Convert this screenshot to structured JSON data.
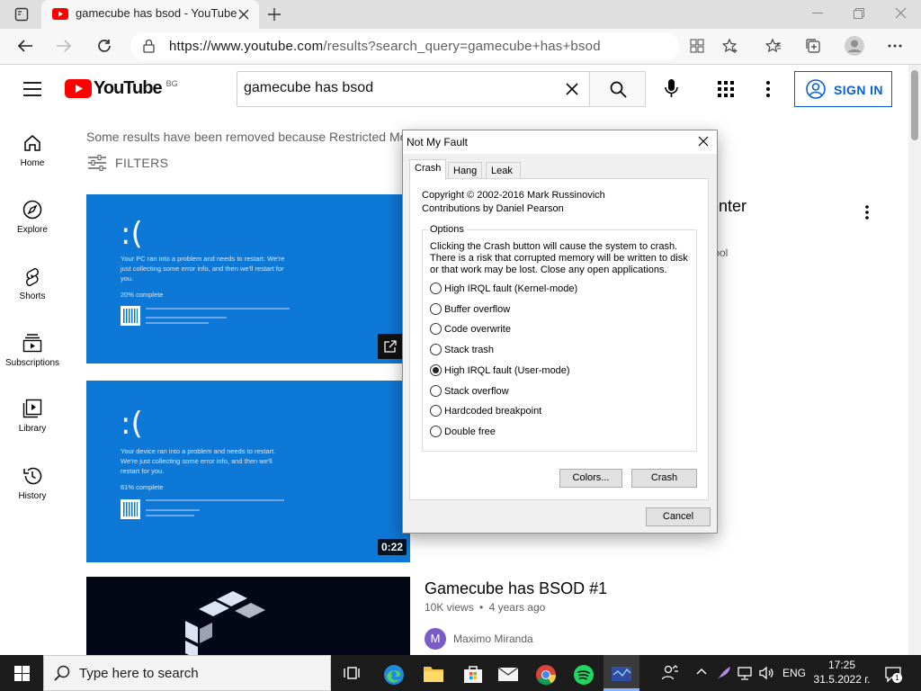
{
  "browser": {
    "tab_title": "gamecube has bsod - YouTube",
    "url_prefix": "https://www.youtube.com",
    "url_rest": "/results?search_query=gamecube+has+bsod"
  },
  "youtube": {
    "logo_text": "YouTube",
    "region": "BG",
    "search_value": "gamecube has bsod",
    "sign_in": "SIGN IN",
    "sidebar": [
      {
        "label": "Home",
        "icon": "home-icon"
      },
      {
        "label": "Explore",
        "icon": "compass-icon"
      },
      {
        "label": "Shorts",
        "icon": "shorts-icon"
      },
      {
        "label": "Subscriptions",
        "icon": "subscriptions-icon"
      },
      {
        "label": "Library",
        "icon": "library-icon"
      },
      {
        "label": "History",
        "icon": "history-icon"
      }
    ],
    "notice": "Some results have been removed because Restricted Mo",
    "filters": "FILTERS",
    "results": [
      {
        "title_fragment": "enter",
        "meta_fragment": "tool",
        "bsod_lines": [
          "Your PC ran into a problem and needs to restart. We're",
          "just collecting some error info, and then we'll restart for",
          "you."
        ],
        "progress": "20% complete"
      },
      {
        "duration": "0:22",
        "bsod_lines": [
          "Your device ran into a problem and needs to restart.",
          "We're just collecting some error info, and then we'll",
          "restart for you."
        ],
        "progress": "61% complete"
      },
      {
        "title": "Gamecube has BSOD #1",
        "views": "10K views",
        "age": "4 years ago",
        "channel": "Maximo Miranda",
        "channel_initial": "M"
      }
    ],
    "bsod_frown": ":("
  },
  "dialog": {
    "title": "Not My Fault",
    "tabs": [
      "Crash",
      "Hang",
      "Leak"
    ],
    "copyright": "Copyright © 2002-2016 Mark Russinovich",
    "contributions": "Contributions by Daniel Pearson",
    "options_label": "Options",
    "description": "Clicking the Crash button will cause the system to crash. There is a risk that corrupted memory will be written to disk or that work may be lost. Close any open applications.",
    "options": [
      {
        "label": "High IRQL fault (Kernel-mode)",
        "selected": false
      },
      {
        "label": "Buffer overflow",
        "selected": false
      },
      {
        "label": "Code overwrite",
        "selected": false
      },
      {
        "label": "Stack trash",
        "selected": false
      },
      {
        "label": "High IRQL fault (User-mode)",
        "selected": true
      },
      {
        "label": "Stack overflow",
        "selected": false
      },
      {
        "label": "Hardcoded breakpoint",
        "selected": false
      },
      {
        "label": "Double free",
        "selected": false
      }
    ],
    "colors_button": "Colors...",
    "crash_button": "Crash",
    "cancel_button": "Cancel"
  },
  "taskbar": {
    "search_placeholder": "Type here to search",
    "language": "ENG",
    "time": "17:25",
    "date": "31.5.2022 г.",
    "notification_count": "1"
  }
}
